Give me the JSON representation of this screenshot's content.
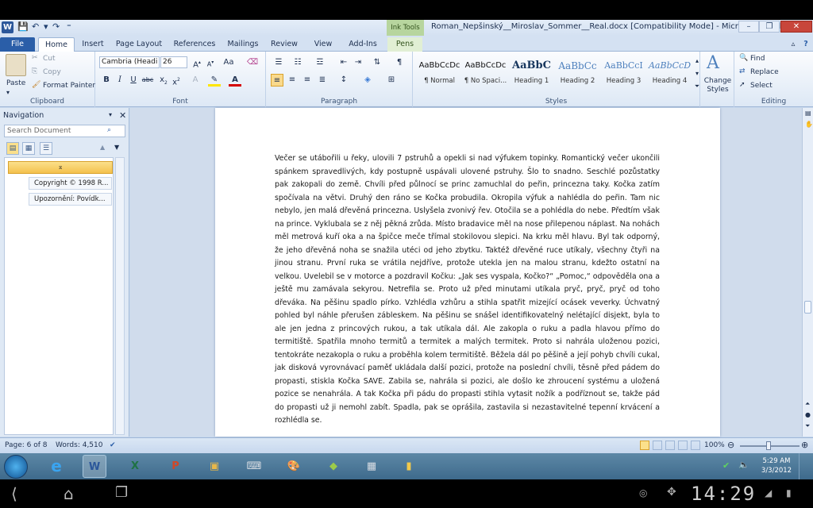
{
  "window": {
    "title": "Roman_Nepšinský__Miroslav_Sommer__Real.docx [Compatibility Mode] - Microsoft Word",
    "context_tab_group": "Ink Tools",
    "minimize": "–",
    "maximize": "❐",
    "close": "✕"
  },
  "tabs": [
    "File",
    "Home",
    "Insert",
    "Page Layout",
    "References",
    "Mailings",
    "Review",
    "View",
    "Add-Ins",
    "Pens"
  ],
  "ribbon": {
    "clipboard": {
      "paste": "Paste",
      "cut": "Cut",
      "copy": "Copy",
      "format_painter": "Format Painter",
      "label": "Clipboard"
    },
    "font": {
      "font_name": "Cambria (Headi",
      "font_size": "26",
      "label": "Font"
    },
    "paragraph": {
      "label": "Paragraph"
    },
    "styles": {
      "items": [
        {
          "sample": "AaBbCcDc",
          "name": "¶ Normal"
        },
        {
          "sample": "AaBbCcDc",
          "name": "¶ No Spaci..."
        },
        {
          "sample": "AaBbC",
          "name": "Heading 1"
        },
        {
          "sample": "AaBbCc",
          "name": "Heading 2"
        },
        {
          "sample": "AaBbCcI",
          "name": "Heading 3"
        },
        {
          "sample": "AaBbCcD",
          "name": "Heading 4"
        }
      ],
      "change_styles": "Change Styles",
      "label": "Styles"
    },
    "editing": {
      "find": "Find",
      "replace": "Replace",
      "select": "Select",
      "label": "Editing"
    }
  },
  "navigation": {
    "title": "Navigation",
    "search_placeholder": "Search Document",
    "items": [
      "⌅",
      "Copyright © 1998 R...",
      "Upozornění: Povídk..."
    ]
  },
  "document": {
    "body": "Večer se utábořili u řeky, ulovili 7 pstruhů a opekli si nad výfukem topinky. Romantický večer ukončili spánkem spravedlivých, kdy postupně uspávali ulovené pstruhy. Šlo to snadno. Seschlé pozůstatky pak zakopali do země. Chvíli před půlnocí se princ zamuchlal do peřin, princezna taky. Kočka zatím spočívala na větvi. Druhý den ráno se Kočka probudila. Okropila výfuk a nahlédla do peřin. Tam nic nebylo, jen malá dřevěná princezna. Uslyšela zvonivý řev. Otočila se a pohlédla do nebe. Předtím však na prince. Vyklubala se z něj pěkná zrůda. Místo bradavice měl na nose přilepenou náplast. Na nohách měl metrová kuří oka a na špičce meče třímal stokilovou slepici. Na krku měl hlavu. Byl tak odporný, že jeho dřevěná noha se snažila utéci od jeho zbytku. Taktéž dřevěné ruce utíkaly, všechny čtyři na jinou stranu. První ruka se vrátila nejdříve, protože utekla jen na malou stranu, kdežto ostatní na velkou. Uvelebil se v motorce a pozdravil Kočku: „Jak ses vyspala, Kočko?“ „Pomoc,“ odpověděla ona a ještě mu zamávala sekyrou. Netrefila se. Proto už před minutami utíkala pryč, pryč, pryč od toho dřeváka. Na pěšinu spadlo pírko. Vzhlédla vzhůru a stihla spatřit mizející ocásek veverky. Úchvatný pohled byl náhle přerušen zábleskem. Na pěšinu se snášel identifikovatelný nelétající disjekt, byla to ale jen jedna z princových rukou, a tak utíkala dál. Ale zakopla o ruku a padla hlavou přímo do termitiště. Spatřila mnoho termitů a termitek a malých termitek. Proto si nahrála uloženou pozici, tentokráte nezakopla o ruku a proběhla kolem termitiště. Běžela dál po pěšině a její pohyb chvíli cukal, jak disková vyrovnávací paměť ukládala další pozici, protože na poslední chvíli, těsně před pádem do propasti, stiskla Kočka SAVE. Zabila se, nahrála si pozici, ale došlo ke zhroucení systému a uložená pozice se nenahrála. A tak Kočka při pádu do propasti stihla vytasit nožík a podříznout se, takže pád do propasti už ji nemohl zabít. Spadla, pak se oprášila, zastavila si nezastavitelné tepenní krvácení a rozhlédla se."
  },
  "status": {
    "page": "Page: 6 of 8",
    "words": "Words: 4,510",
    "zoom": "100%"
  },
  "taskbar": {
    "time": "5:29 AM",
    "date": "3/3/2012"
  },
  "android": {
    "clock": "14:29"
  }
}
